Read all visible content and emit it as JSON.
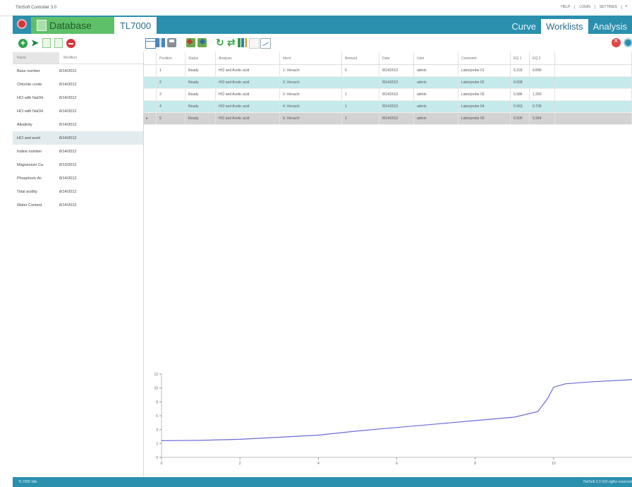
{
  "window": {
    "title": "TitriSoft Controller 3.0"
  },
  "top_menu": {
    "items": [
      "HELP",
      "LOGIN",
      "SETTINGS"
    ],
    "close": "×"
  },
  "navbar": {
    "database_tab": "Database",
    "instrument_tab": "TL7000",
    "right_tabs": [
      "Curve",
      "Worklists",
      "Analysis"
    ],
    "active_tab": "Worklists"
  },
  "sidebar": {
    "columns": [
      "Name",
      "Modified"
    ],
    "rows": [
      {
        "name": "Base number",
        "modified": "8/14/2012"
      },
      {
        "name": "Chloride conte",
        "modified": "8/14/2012"
      },
      {
        "name": "HCl with NaOH",
        "modified": "8/14/2012"
      },
      {
        "name": "HCl with NaOH",
        "modified": "8/14/2012"
      },
      {
        "name": "Alkalinity",
        "modified": "8/14/2012"
      },
      {
        "name": "HCl and aceti",
        "modified": "8/14/2012"
      },
      {
        "name": "Iodine number",
        "modified": "8/14/2012"
      },
      {
        "name": "Magnesium Ca",
        "modified": "8/13/2012"
      },
      {
        "name": "Phosphoric Ac",
        "modified": "8/14/2012"
      },
      {
        "name": "Total acidity",
        "modified": "8/14/2012"
      },
      {
        "name": "Water Content",
        "modified": "8/14/2012"
      }
    ],
    "selected_index": 5
  },
  "grid": {
    "columns": [
      "Position",
      "Status",
      "Analysis",
      "Ident",
      "Amount",
      "Date",
      "User",
      "Comment",
      "EQ 1",
      "EQ 2"
    ],
    "current_row_marker": "▸",
    "rows": [
      {
        "pos": "1",
        "status": "Ready",
        "analysis": "HCl and Acetic acid",
        "ident": "1. Versuch",
        "amount": "5",
        "date": "8/14/2012",
        "user": "admin",
        "comment": "Laborprobe 01",
        "eq1": "5.103",
        "eq2": "9.890"
      },
      {
        "pos": "2",
        "status": "Ready",
        "analysis": "HCl and Acetic acid",
        "ident": "2. Versuch",
        "amount": "",
        "date": "8/14/2012",
        "user": "admin",
        "comment": "Laborprobe 02",
        "eq1": "9.938",
        "eq2": ""
      },
      {
        "pos": "3",
        "status": "Ready",
        "analysis": "HCl and Acetic acid",
        "ident": "3. Versuch",
        "amount": "1",
        "date": "8/14/2012",
        "user": "admin",
        "comment": "Laborprobe 03",
        "eq1": "5.586",
        "eq2": "1.250"
      },
      {
        "pos": "4",
        "status": "Ready",
        "analysis": "HCl and Acetic acid",
        "ident": "4. Versuch",
        "amount": "1",
        "date": "8/14/2012",
        "user": "admin",
        "comment": "Laborprobe 04",
        "eq1": "5.563",
        "eq2": "0.709"
      },
      {
        "pos": "5",
        "status": "Ready",
        "analysis": "HCl and Acetic acid",
        "ident": "5. Versuch",
        "amount": "1",
        "date": "8/14/2012",
        "user": "admin",
        "comment": "Laborprobe 05",
        "eq1": "5.505",
        "eq2": "5.954"
      }
    ]
  },
  "chart_data": {
    "type": "line",
    "xlim": [
      0,
      12
    ],
    "ylim": [
      0,
      12
    ],
    "xticks": [
      "0",
      "2",
      "4",
      "6",
      "8",
      "10"
    ],
    "yticks": [
      "0",
      "2",
      "4",
      "6",
      "8",
      "10",
      "12"
    ],
    "line_color": "#6b6bd6",
    "series": [
      {
        "x": [
          0,
          1,
          2,
          3,
          4,
          5,
          6,
          7,
          8,
          9,
          9.6,
          9.85,
          10.0,
          10.3,
          11,
          12
        ],
        "y": [
          2.4,
          2.45,
          2.6,
          2.9,
          3.2,
          3.8,
          4.3,
          4.8,
          5.3,
          5.8,
          6.6,
          8.5,
          10.1,
          10.6,
          10.9,
          11.2
        ]
      }
    ]
  },
  "status_bar": {
    "left": "TL7000 Idle",
    "right": "TitriSoft 3.0 SI® rights reserved"
  }
}
